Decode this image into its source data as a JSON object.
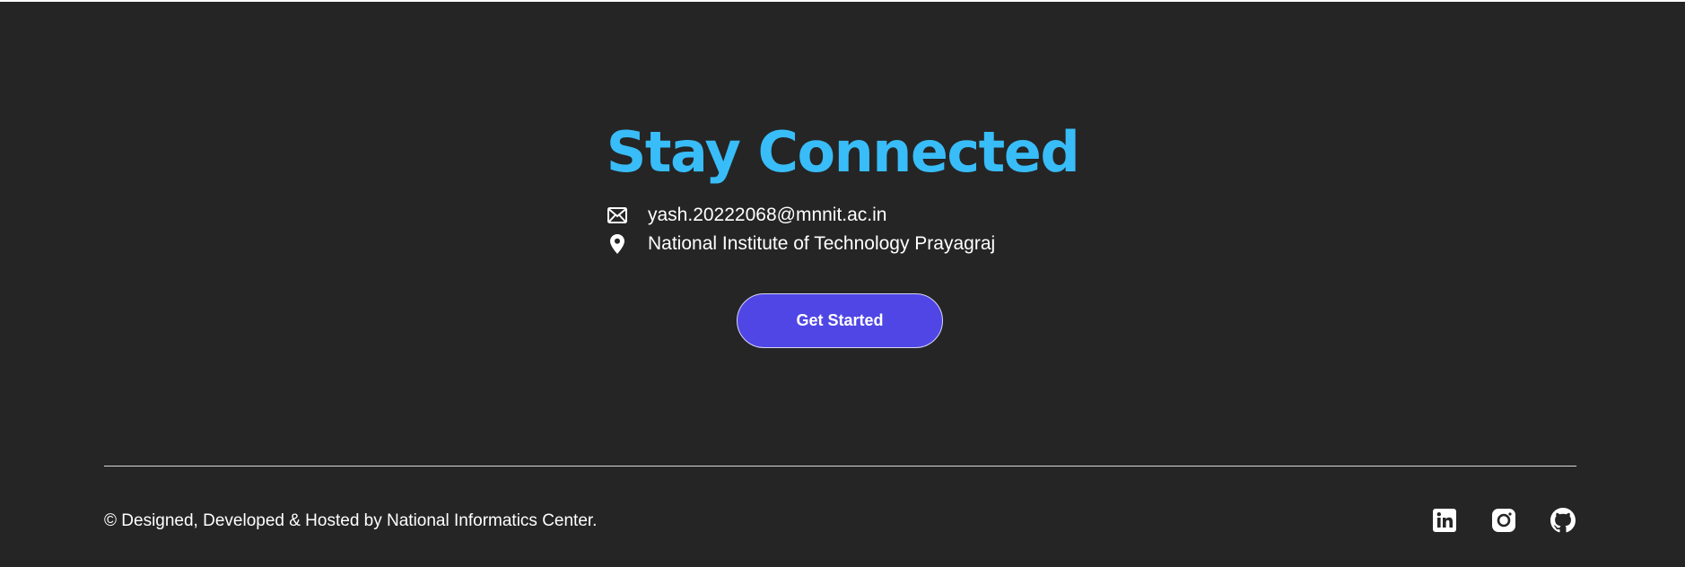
{
  "hero": {
    "title": "Stay Connected",
    "contacts": [
      {
        "icon": "envelope-icon",
        "text": "yash.20222068@mnnit.ac.in"
      },
      {
        "icon": "map-pin-icon",
        "text": "National Institute of Technology Prayagraj"
      }
    ],
    "cta_label": "Get Started"
  },
  "footer": {
    "copyright": "© Designed, Developed & Hosted by National Informatics Center.",
    "socials": [
      {
        "icon": "linkedin-icon"
      },
      {
        "icon": "instagram-icon"
      },
      {
        "icon": "github-icon"
      }
    ]
  },
  "colors": {
    "background": "#252525",
    "title": "#38bdf8",
    "button": "#4f46e5",
    "text": "#ffffff"
  }
}
